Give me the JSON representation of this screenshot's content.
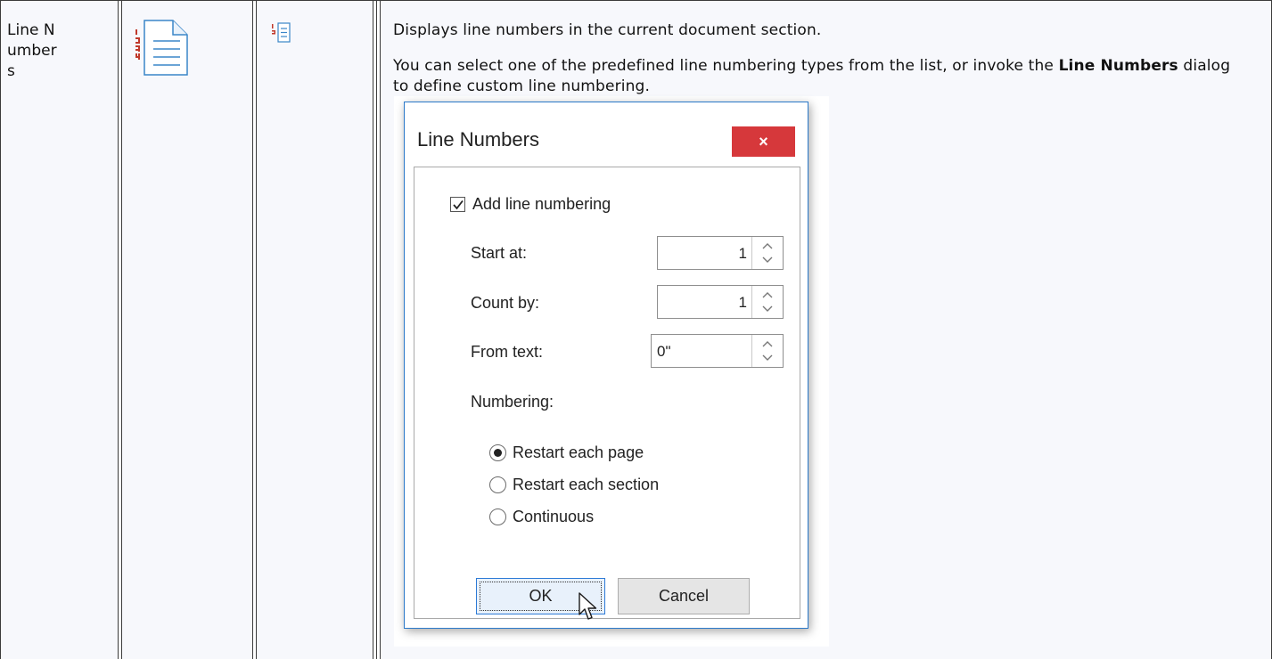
{
  "row": {
    "command_name": "Line Numbers",
    "description_line1": "Displays line numbers in the current document section.",
    "description_line2_before": "You can select one of the predefined line numbering types from the list, or invoke the ",
    "description_line2_bold": "Line Numbers",
    "description_line2_after": " dialog to define custom line numbering."
  },
  "icons": {
    "large": "line-numbers-large-icon",
    "small": "line-numbers-small-icon"
  },
  "dialog": {
    "title": "Line Numbers",
    "close_glyph": "×",
    "add_line_numbering": {
      "label": "Add line numbering",
      "checked": true
    },
    "start_at": {
      "label": "Start at:",
      "value": "1"
    },
    "count_by": {
      "label": "Count by:",
      "value": "1"
    },
    "from_text": {
      "label": "From text:",
      "value": "0\""
    },
    "numbering_label": "Numbering:",
    "numbering_options": [
      {
        "label": "Restart each page",
        "selected": true
      },
      {
        "label": "Restart each section",
        "selected": false
      },
      {
        "label": "Continuous",
        "selected": false
      }
    ],
    "ok_label": "OK",
    "cancel_label": "Cancel"
  },
  "colors": {
    "close_button": "#d6383b",
    "dialog_border": "#2b79c9",
    "cell_background": "#f7f8fc",
    "icon_accent": "#c0392b",
    "icon_lines": "#3a86c8"
  }
}
